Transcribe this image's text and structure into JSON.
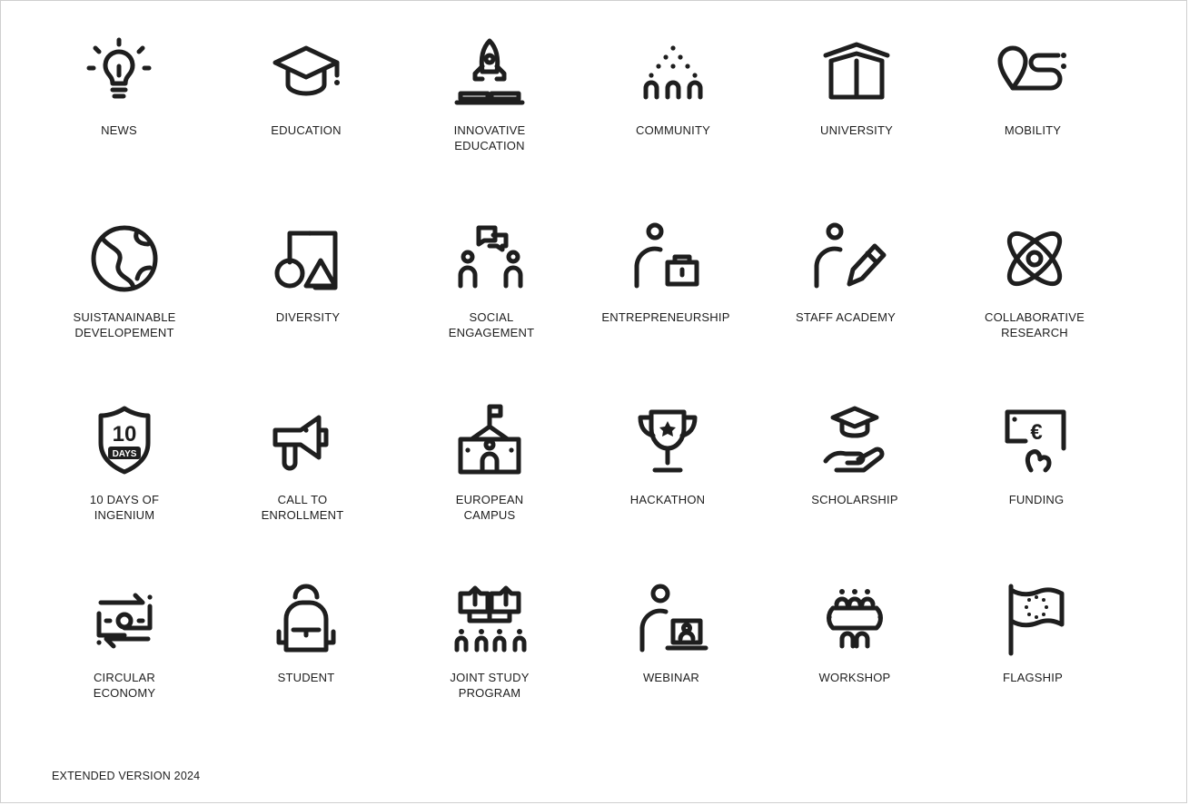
{
  "icons": [
    {
      "icon": "lightbulb-icon",
      "label": "NEWS"
    },
    {
      "icon": "graduation-cap-icon",
      "label": "EDUCATION"
    },
    {
      "icon": "rocket-book-icon",
      "label": "INNOVATIVE\nEDUCATION"
    },
    {
      "icon": "people-group-icon",
      "label": "COMMUNITY"
    },
    {
      "icon": "university-building-icon",
      "label": "UNIVERSITY"
    },
    {
      "icon": "route-pin-icon",
      "label": "MOBILITY"
    },
    {
      "icon": "globe-icon",
      "label": "SUISTANAINABLE\nDEVELOPEMENT"
    },
    {
      "icon": "shapes-icon",
      "label": "DIVERSITY"
    },
    {
      "icon": "chat-people-icon",
      "label": "SOCIAL\nENGAGEMENT"
    },
    {
      "icon": "person-briefcase-icon",
      "label": "ENTREPRENEURSHIP"
    },
    {
      "icon": "person-pen-icon",
      "label": "STAFF ACADEMY"
    },
    {
      "icon": "atom-icon",
      "label": "COLLABORATIVE\nRESEARCH"
    },
    {
      "icon": "ten-days-shield-icon",
      "label": "10 DAYS OF\nINGENIUM",
      "badge_top": "10",
      "badge_bottom": "DAYS"
    },
    {
      "icon": "megaphone-icon",
      "label": "CALL TO\nENROLLMENT"
    },
    {
      "icon": "campus-flag-icon",
      "label": "EUROPEAN\nCAMPUS"
    },
    {
      "icon": "trophy-icon",
      "label": "HACKATHON"
    },
    {
      "icon": "hand-cap-icon",
      "label": "SCHOLARSHIP"
    },
    {
      "icon": "euro-board-icon",
      "label": "FUNDING",
      "symbol": "€"
    },
    {
      "icon": "money-cycle-icon",
      "label": "CIRCULAR\nECONOMY"
    },
    {
      "icon": "backpack-icon",
      "label": "STUDENT"
    },
    {
      "icon": "joint-program-icon",
      "label": "JOINT STUDY\nPROGRAM"
    },
    {
      "icon": "person-laptop-icon",
      "label": "WEBINAR"
    },
    {
      "icon": "workshop-table-icon",
      "label": "WORKSHOP"
    },
    {
      "icon": "eu-flag-icon",
      "label": "FLAGSHIP"
    }
  ],
  "footer": {
    "text": "EXTENDED VERSION 2024"
  },
  "colors": {
    "ink": "#1e1e1e",
    "background": "#ffffff",
    "border": "#cfcfcf"
  }
}
